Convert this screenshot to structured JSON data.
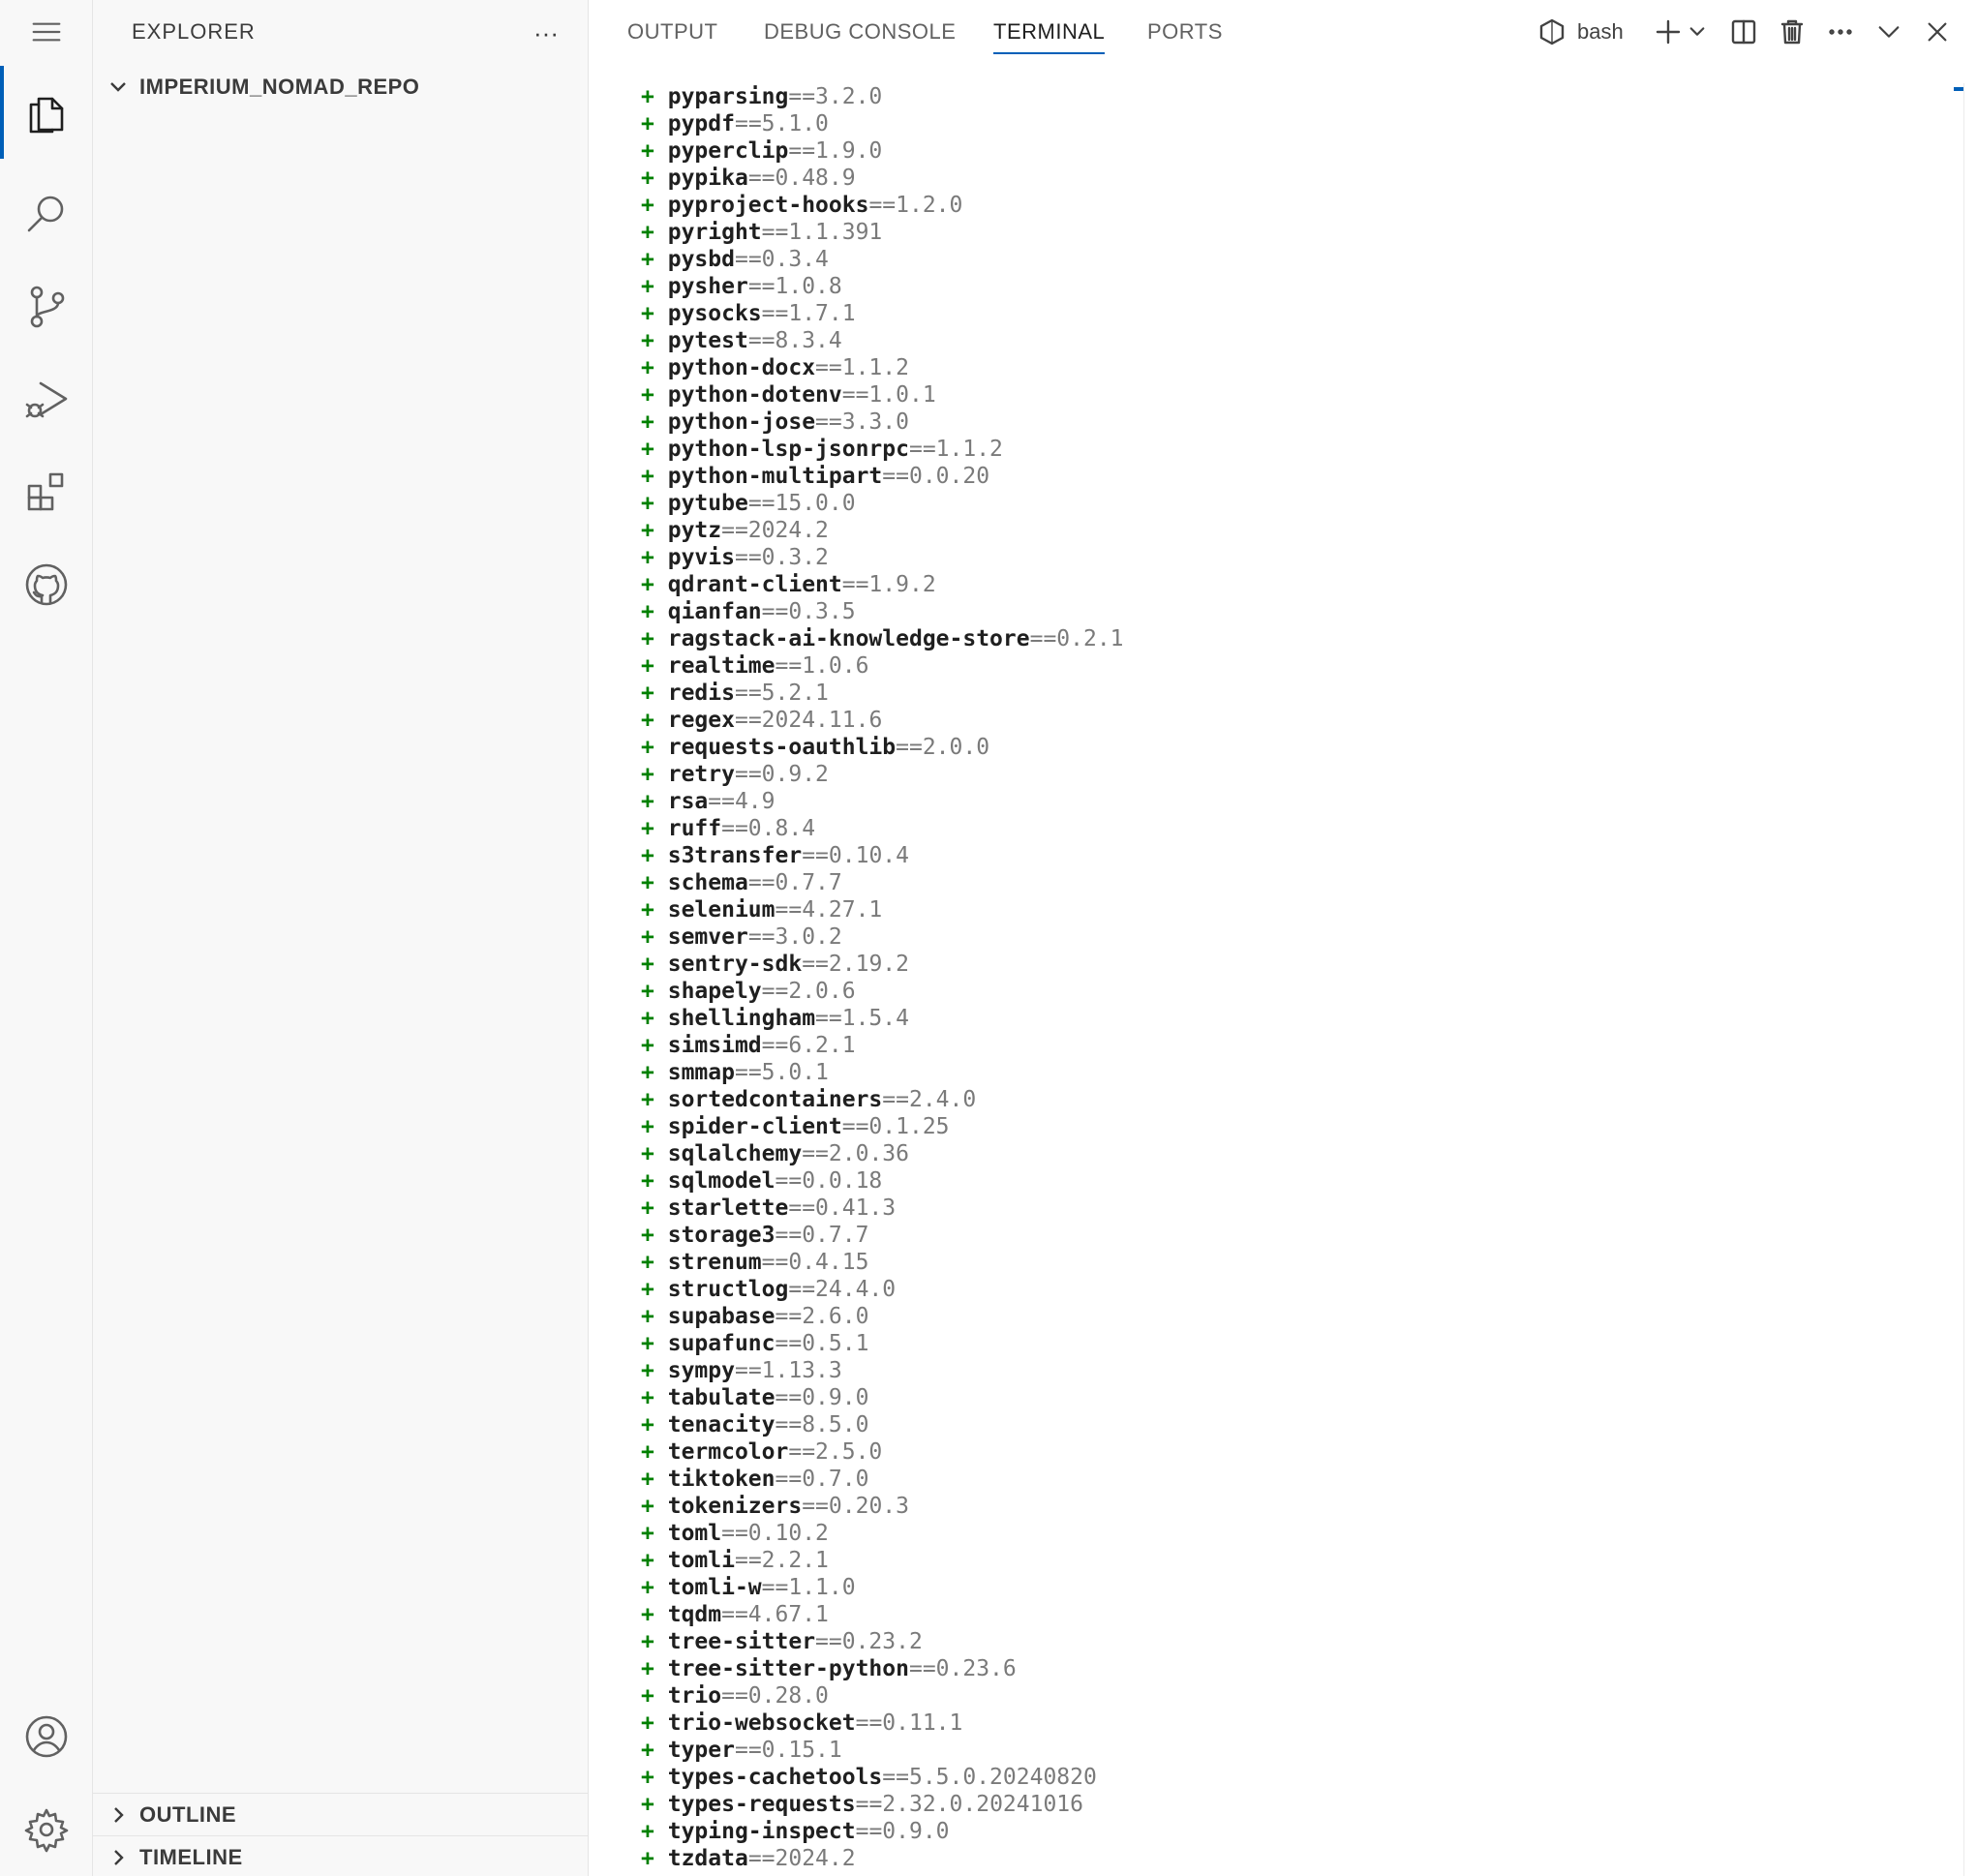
{
  "activity_bar": {
    "items": [
      "menu",
      "explorer",
      "search",
      "source-control",
      "run-debug",
      "extensions",
      "github",
      "accounts",
      "manage"
    ]
  },
  "sidebar": {
    "title": "EXPLORER",
    "more": "···",
    "repo": "IMPERIUM_NOMAD_REPO",
    "outline": "OUTLINE",
    "timeline": "TIMELINE"
  },
  "panel": {
    "tabs": [
      "OUTPUT",
      "DEBUG CONSOLE",
      "TERMINAL",
      "PORTS"
    ],
    "active_tab": "TERMINAL",
    "shell": "bash"
  },
  "terminal": {
    "lines": [
      {
        "p": "+",
        "pkg": "pyparsing",
        "ver": "==3.2.0"
      },
      {
        "p": "+",
        "pkg": "pypdf",
        "ver": "==5.1.0"
      },
      {
        "p": "+",
        "pkg": "pyperclip",
        "ver": "==1.9.0"
      },
      {
        "p": "+",
        "pkg": "pypika",
        "ver": "==0.48.9"
      },
      {
        "p": "+",
        "pkg": "pyproject-hooks",
        "ver": "==1.2.0"
      },
      {
        "p": "+",
        "pkg": "pyright",
        "ver": "==1.1.391"
      },
      {
        "p": "+",
        "pkg": "pysbd",
        "ver": "==0.3.4"
      },
      {
        "p": "+",
        "pkg": "pysher",
        "ver": "==1.0.8"
      },
      {
        "p": "+",
        "pkg": "pysocks",
        "ver": "==1.7.1"
      },
      {
        "p": "+",
        "pkg": "pytest",
        "ver": "==8.3.4"
      },
      {
        "p": "+",
        "pkg": "python-docx",
        "ver": "==1.1.2"
      },
      {
        "p": "+",
        "pkg": "python-dotenv",
        "ver": "==1.0.1"
      },
      {
        "p": "+",
        "pkg": "python-jose",
        "ver": "==3.3.0"
      },
      {
        "p": "+",
        "pkg": "python-lsp-jsonrpc",
        "ver": "==1.1.2"
      },
      {
        "p": "+",
        "pkg": "python-multipart",
        "ver": "==0.0.20"
      },
      {
        "p": "+",
        "pkg": "pytube",
        "ver": "==15.0.0"
      },
      {
        "p": "+",
        "pkg": "pytz",
        "ver": "==2024.2"
      },
      {
        "p": "+",
        "pkg": "pyvis",
        "ver": "==0.3.2"
      },
      {
        "p": "+",
        "pkg": "qdrant-client",
        "ver": "==1.9.2"
      },
      {
        "p": "+",
        "pkg": "qianfan",
        "ver": "==0.3.5"
      },
      {
        "p": "+",
        "pkg": "ragstack-ai-knowledge-store",
        "ver": "==0.2.1"
      },
      {
        "p": "+",
        "pkg": "realtime",
        "ver": "==1.0.6"
      },
      {
        "p": "+",
        "pkg": "redis",
        "ver": "==5.2.1"
      },
      {
        "p": "+",
        "pkg": "regex",
        "ver": "==2024.11.6"
      },
      {
        "p": "+",
        "pkg": "requests-oauthlib",
        "ver": "==2.0.0"
      },
      {
        "p": "+",
        "pkg": "retry",
        "ver": "==0.9.2"
      },
      {
        "p": "+",
        "pkg": "rsa",
        "ver": "==4.9"
      },
      {
        "p": "+",
        "pkg": "ruff",
        "ver": "==0.8.4"
      },
      {
        "p": "+",
        "pkg": "s3transfer",
        "ver": "==0.10.4"
      },
      {
        "p": "+",
        "pkg": "schema",
        "ver": "==0.7.7"
      },
      {
        "p": "+",
        "pkg": "selenium",
        "ver": "==4.27.1"
      },
      {
        "p": "+",
        "pkg": "semver",
        "ver": "==3.0.2"
      },
      {
        "p": "+",
        "pkg": "sentry-sdk",
        "ver": "==2.19.2"
      },
      {
        "p": "+",
        "pkg": "shapely",
        "ver": "==2.0.6"
      },
      {
        "p": "+",
        "pkg": "shellingham",
        "ver": "==1.5.4"
      },
      {
        "p": "+",
        "pkg": "simsimd",
        "ver": "==6.2.1"
      },
      {
        "p": "+",
        "pkg": "smmap",
        "ver": "==5.0.1"
      },
      {
        "p": "+",
        "pkg": "sortedcontainers",
        "ver": "==2.4.0"
      },
      {
        "p": "+",
        "pkg": "spider-client",
        "ver": "==0.1.25"
      },
      {
        "p": "+",
        "pkg": "sqlalchemy",
        "ver": "==2.0.36"
      },
      {
        "p": "+",
        "pkg": "sqlmodel",
        "ver": "==0.0.18"
      },
      {
        "p": "+",
        "pkg": "starlette",
        "ver": "==0.41.3"
      },
      {
        "p": "+",
        "pkg": "storage3",
        "ver": "==0.7.7"
      },
      {
        "p": "+",
        "pkg": "strenum",
        "ver": "==0.4.15"
      },
      {
        "p": "+",
        "pkg": "structlog",
        "ver": "==24.4.0"
      },
      {
        "p": "+",
        "pkg": "supabase",
        "ver": "==2.6.0"
      },
      {
        "p": "+",
        "pkg": "supafunc",
        "ver": "==0.5.1"
      },
      {
        "p": "+",
        "pkg": "sympy",
        "ver": "==1.13.3"
      },
      {
        "p": "+",
        "pkg": "tabulate",
        "ver": "==0.9.0"
      },
      {
        "p": "+",
        "pkg": "tenacity",
        "ver": "==8.5.0"
      },
      {
        "p": "+",
        "pkg": "termcolor",
        "ver": "==2.5.0"
      },
      {
        "p": "+",
        "pkg": "tiktoken",
        "ver": "==0.7.0"
      },
      {
        "p": "+",
        "pkg": "tokenizers",
        "ver": "==0.20.3"
      },
      {
        "p": "+",
        "pkg": "toml",
        "ver": "==0.10.2"
      },
      {
        "p": "+",
        "pkg": "tomli",
        "ver": "==2.2.1"
      },
      {
        "p": "+",
        "pkg": "tomli-w",
        "ver": "==1.1.0"
      },
      {
        "p": "+",
        "pkg": "tqdm",
        "ver": "==4.67.1"
      },
      {
        "p": "+",
        "pkg": "tree-sitter",
        "ver": "==0.23.2"
      },
      {
        "p": "+",
        "pkg": "tree-sitter-python",
        "ver": "==0.23.6"
      },
      {
        "p": "+",
        "pkg": "trio",
        "ver": "==0.28.0"
      },
      {
        "p": "+",
        "pkg": "trio-websocket",
        "ver": "==0.11.1"
      },
      {
        "p": "+",
        "pkg": "typer",
        "ver": "==0.15.1"
      },
      {
        "p": "+",
        "pkg": "types-cachetools",
        "ver": "==5.5.0.20240820"
      },
      {
        "p": "+",
        "pkg": "types-requests",
        "ver": "==2.32.0.20241016"
      },
      {
        "p": "+",
        "pkg": "typing-inspect",
        "ver": "==0.9.0"
      },
      {
        "p": "+",
        "pkg": "tzdata",
        "ver": "==2024.2"
      }
    ]
  },
  "colors": {
    "plus": "#008000",
    "accent": "#005fb8",
    "version": "#7a7a7a"
  }
}
